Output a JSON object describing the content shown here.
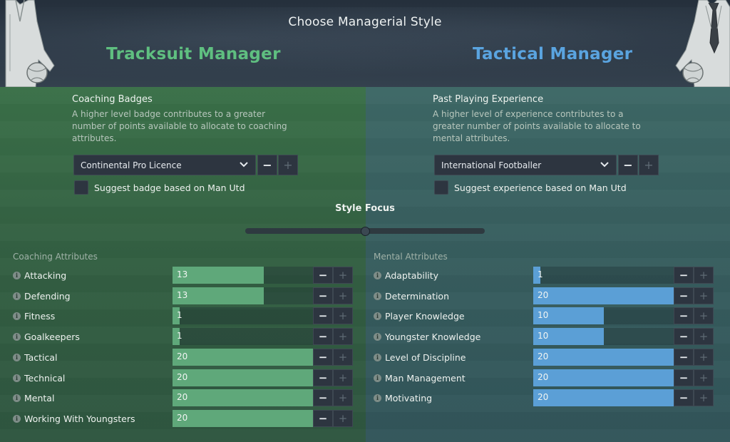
{
  "header": {
    "title": "Choose Managerial Style",
    "left_style": "Tracksuit Manager",
    "right_style": "Tactical Manager"
  },
  "coaching": {
    "title": "Coaching Badges",
    "description": "A higher level badge contributes to a greater number of points available to allocate to coaching attributes.",
    "selected": "Continental Pro Licence",
    "suggest_label": "Suggest badge based on Man Utd"
  },
  "playing": {
    "title": "Past Playing Experience",
    "description": "A higher level of experience contributes to a greater number of points available to allocate to mental attributes.",
    "selected": "International Footballer",
    "suggest_label": "Suggest experience based on Man Utd"
  },
  "style_focus": {
    "label": "Style Focus",
    "value": 0.5
  },
  "buttons": {
    "minus": "−",
    "plus": "+"
  },
  "coaching_attributes": {
    "heading": "Coaching Attributes",
    "items": [
      {
        "name": "Attacking",
        "value": 13
      },
      {
        "name": "Defending",
        "value": 13
      },
      {
        "name": "Fitness",
        "value": 1
      },
      {
        "name": "Goalkeepers",
        "value": 1
      },
      {
        "name": "Tactical",
        "value": 20
      },
      {
        "name": "Technical",
        "value": 20
      },
      {
        "name": "Mental",
        "value": 20
      },
      {
        "name": "Working With Youngsters",
        "value": 20
      }
    ]
  },
  "mental_attributes": {
    "heading": "Mental Attributes",
    "items": [
      {
        "name": "Adaptability",
        "value": 1
      },
      {
        "name": "Determination",
        "value": 20
      },
      {
        "name": "Player Knowledge",
        "value": 10
      },
      {
        "name": "Youngster Knowledge",
        "value": 10
      },
      {
        "name": "Level of Discipline",
        "value": 20
      },
      {
        "name": "Man Management",
        "value": 20
      },
      {
        "name": "Motivating",
        "value": 20
      }
    ]
  },
  "attribute_max": 20,
  "colors": {
    "tracksuit": "#5fbf80",
    "tactical": "#5aa4e0",
    "coaching_bar": "#5fa87a",
    "mental_bar": "#5b9fd6"
  }
}
